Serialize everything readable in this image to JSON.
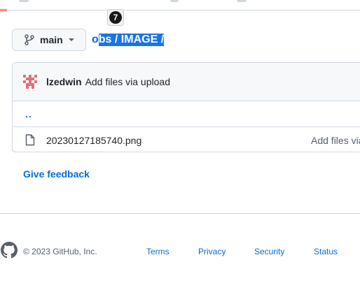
{
  "step_badge": "7",
  "branch": {
    "name": "main"
  },
  "breadcrumb": {
    "part1_plain": "o",
    "part1_selected": "bs",
    "sep1": " / ",
    "part2": "IMAGE",
    "sep2": " /"
  },
  "commit": {
    "author": "lzedwin",
    "message": "Add files via upload"
  },
  "parent_dir": "..",
  "files": [
    {
      "name": "20230127185740.png",
      "commit_message": "Add files via"
    }
  ],
  "feedback_label": "Give feedback",
  "footer": {
    "copyright": "© 2023 GitHub, Inc.",
    "links": [
      "Terms",
      "Privacy",
      "Security",
      "Status"
    ]
  }
}
